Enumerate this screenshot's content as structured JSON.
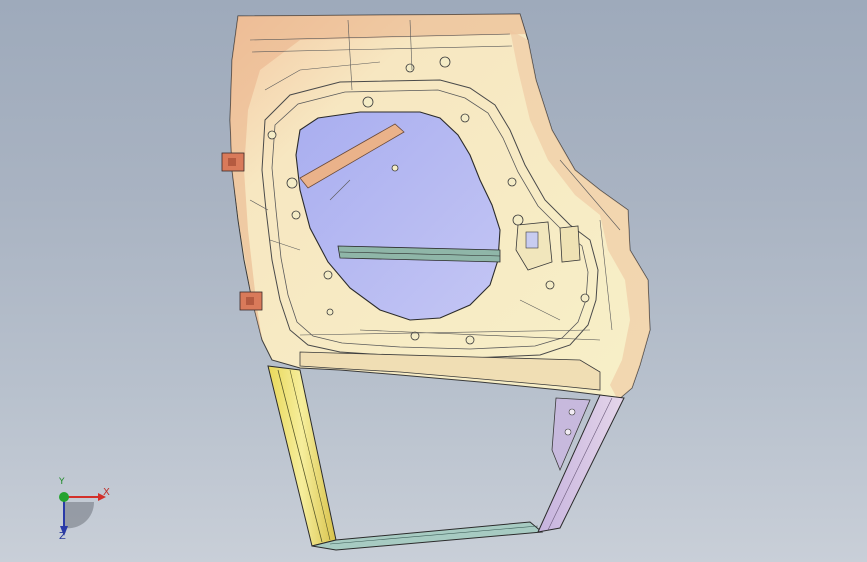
{
  "viewport": {
    "background_top": "#9eaabb",
    "background_bottom": "#c9cfd8"
  },
  "model": {
    "part": "door-inner-panel",
    "colors": {
      "panel_fill": "#f6eec2",
      "panel_edge": "#d88a5c",
      "window_fill": "#b9bdf2",
      "frame_yellow": "#eee07a",
      "frame_teal": "#9fc8c2",
      "frame_lilac": "#c9b9e0",
      "outline": "#2b2b2b"
    }
  },
  "triad": {
    "x_label": "X",
    "y_label": "Y",
    "z_label": "Z",
    "colors": {
      "x": "#d3302a",
      "y": "#25a32f",
      "z": "#2a3aa8"
    }
  }
}
